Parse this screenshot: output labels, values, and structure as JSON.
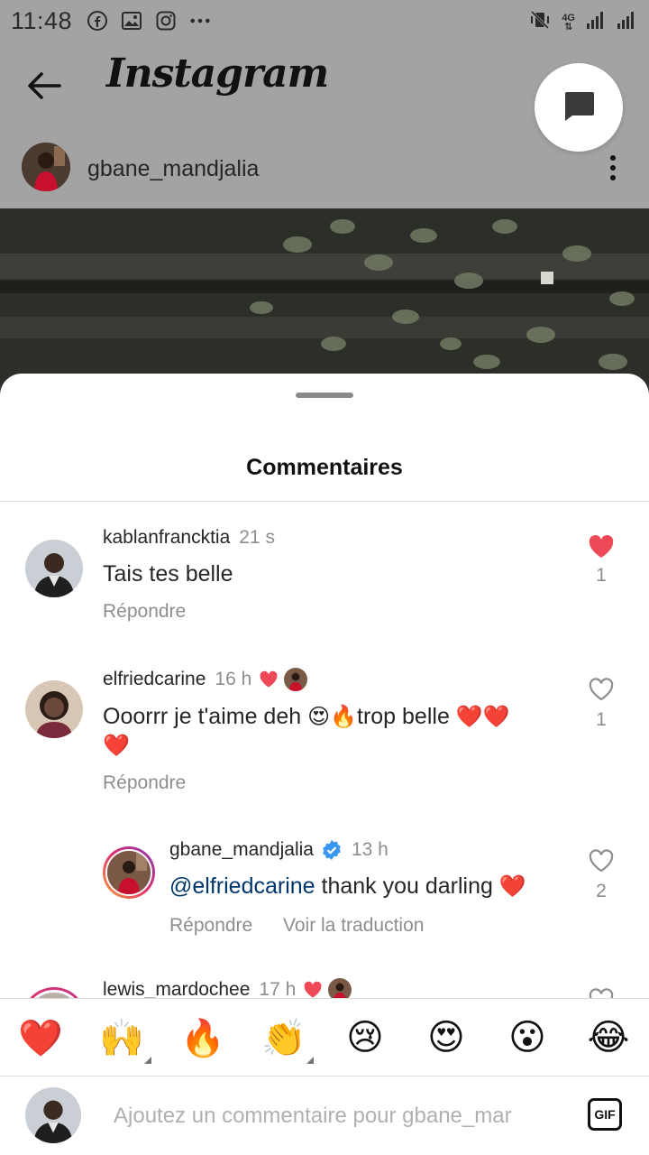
{
  "status_bar": {
    "time": "11:48",
    "left_icons": [
      "facebook-icon",
      "gallery-icon",
      "instagram-icon",
      "more-dots-icon"
    ],
    "right_icons": [
      "vibrate-mute-icon",
      "4g-icon",
      "signal-icon",
      "signal-icon-2"
    ],
    "network_label": "4G"
  },
  "header": {
    "title": "Instagram",
    "back_icon": "arrow-left-icon",
    "messages_icon": "chat-bubble-icon"
  },
  "post": {
    "owner": "gbane_mandjalia",
    "menu_icon": "vertical-dots-icon"
  },
  "sheet": {
    "title": "Commentaires"
  },
  "comments": [
    {
      "username": "kablanfrancktia",
      "time": "21 s",
      "text": "Tais tes belle",
      "reply_label": "Répondre",
      "liked": true,
      "like_count": "1"
    },
    {
      "username": "elfriedcarine",
      "time": "16 h",
      "creator_liked": true,
      "text_part1": "Ooorrr je t'aime deh ",
      "emoji1": "😍🔥",
      "text_part2": "trop belle ",
      "emoji2": "❤️❤️",
      "emoji3": "❤️",
      "reply_label": "Répondre",
      "liked": false,
      "like_count": "1"
    },
    {
      "username": "gbane_mandjalia",
      "verified": true,
      "time": "13 h",
      "mention": "@elfriedcarine",
      "text": " thank you darling ",
      "emoji": "❤️",
      "reply_label": "Répondre",
      "translate_label": "Voir la traduction",
      "liked": false,
      "like_count": "2"
    },
    {
      "username": "lewis_mardochee",
      "time": "17 h",
      "creator_liked": true
    }
  ],
  "emoji_bar": [
    "❤️",
    "🙌",
    "🔥",
    "👏",
    "😢",
    "😍",
    "😮",
    "😂"
  ],
  "input": {
    "placeholder": "Ajoutez un commentaire pour gbane_mar",
    "gif_label": "GIF"
  },
  "colors": {
    "like_red": "#ed4956",
    "mention_blue": "#00376b",
    "verified_blue": "#3897f0",
    "secondary_text": "#8e8e8e"
  }
}
